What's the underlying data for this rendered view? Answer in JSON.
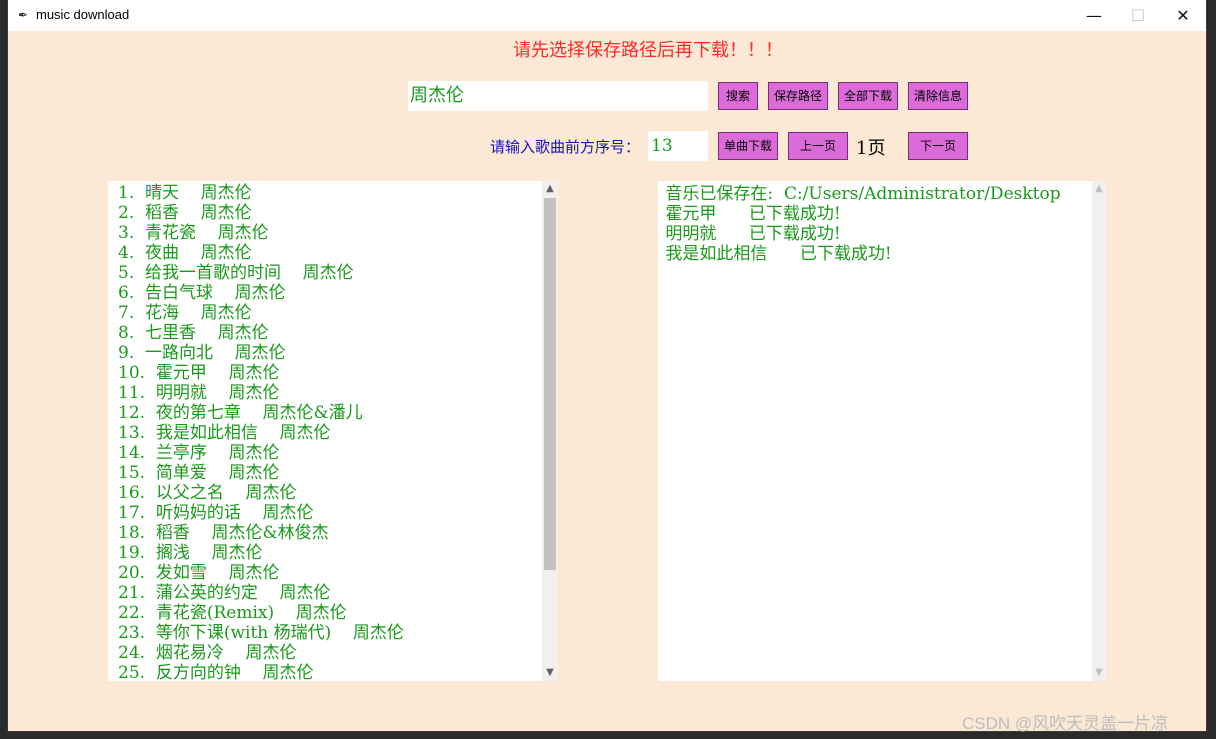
{
  "window": {
    "title": "music download",
    "minimize": "—",
    "maximize": "☐",
    "close": "✕"
  },
  "warning": "请先选择保存路径后再下载！！！",
  "search": {
    "value": "周杰伦"
  },
  "buttons": {
    "search": "搜索",
    "save_path": "保存路径",
    "download_all": "全部下载",
    "clear_info": "清除信息",
    "single_download": "单曲下载",
    "prev_page": "上一页",
    "next_page": "下一页"
  },
  "index_prompt": "请输入歌曲前方序号：",
  "index_value": "13",
  "page_label": "1页",
  "songs": [
    "1.  晴天    周杰伦",
    "2.  稻香    周杰伦",
    "3.  青花瓷    周杰伦",
    "4.  夜曲    周杰伦",
    "5.  给我一首歌的时间    周杰伦",
    "6.  告白气球    周杰伦",
    "7.  花海    周杰伦",
    "8.  七里香    周杰伦",
    "9.  一路向北    周杰伦",
    "10.  霍元甲    周杰伦",
    "11.  明明就    周杰伦",
    "12.  夜的第七章    周杰伦&潘儿",
    "13.  我是如此相信    周杰伦",
    "14.  兰亭序    周杰伦",
    "15.  简单爱    周杰伦",
    "16.  以父之名    周杰伦",
    "17.  听妈妈的话    周杰伦",
    "18.  稻香    周杰伦&林俊杰",
    "19.  搁浅    周杰伦",
    "20.  发如雪    周杰伦",
    "21.  蒲公英的约定    周杰伦",
    "22.  青花瓷(Remix)    周杰伦",
    "23.  等你下课(with 杨瑞代)    周杰伦",
    "24.  烟花易冷    周杰伦",
    "25.  反方向的钟    周杰伦"
  ],
  "info_text": " 音乐已保存在:  C:/Users/Administrator/Desktop\n 霍元甲      已下载成功!\n 明明就      已下载成功!\n 我是如此相信      已下载成功!",
  "scroll": {
    "up": "▲",
    "down": "▼"
  },
  "watermark": "CSDN @风吹天灵盖一片凉"
}
